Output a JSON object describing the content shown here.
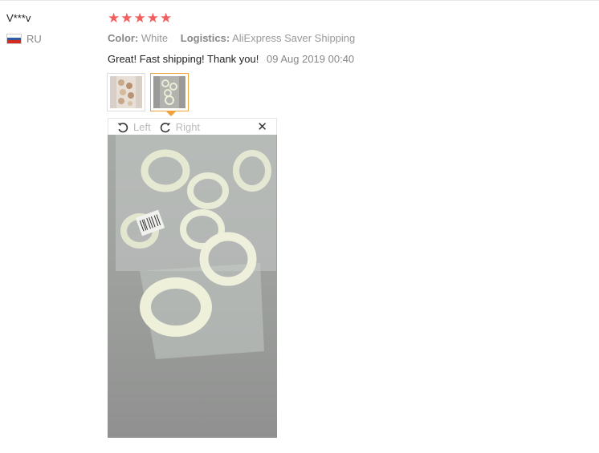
{
  "review": {
    "user": "V***v",
    "country_code": "RU",
    "rating": 5,
    "stars": [
      "★",
      "★",
      "★",
      "★",
      "★"
    ],
    "star_color": "#f25d5d",
    "color_label": "Color:",
    "color_value": "White",
    "logistics_label": "Logistics:",
    "logistics_value": "AliExpress Saver Shipping",
    "text": "Great! Fast shipping! Thank you!",
    "date": "09 Aug 2019 00:40"
  },
  "viewer": {
    "rotate_left_label": "Left",
    "rotate_right_label": "Right",
    "close_label": "✕",
    "accent_color": "#f0a23a"
  }
}
